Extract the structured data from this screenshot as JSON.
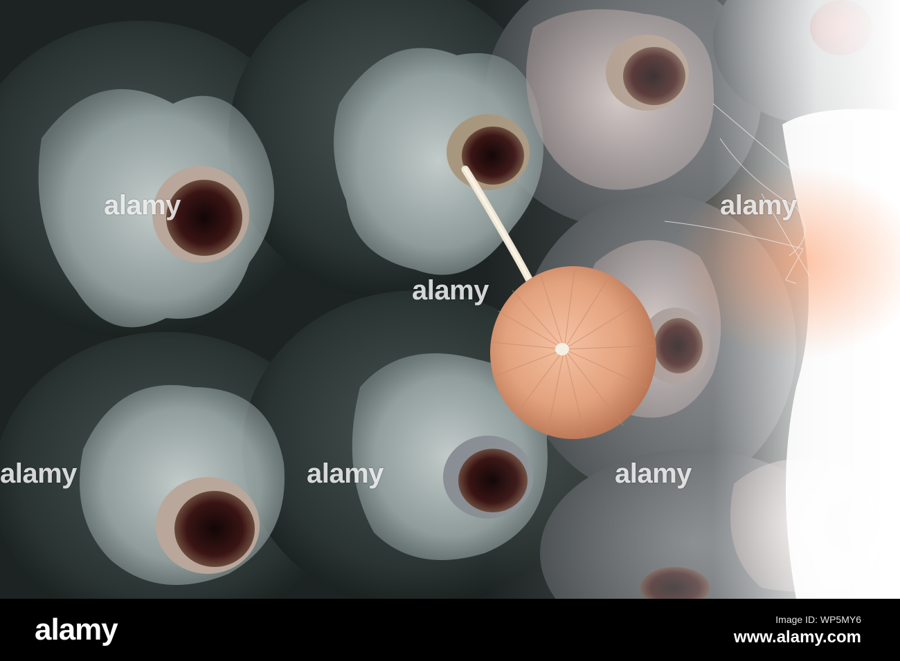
{
  "watermark_text": "alamy",
  "footer": {
    "logo": "alamy",
    "caption": "Image ID: WP5MY6",
    "url": "www.alamy.com"
  },
  "colors": {
    "background_dark": "#1c2322",
    "bag_plastic": "#aeb9b8",
    "mushroom_cap": "#e3a27e",
    "highlight": "#ffffff",
    "footer": "#000000"
  }
}
